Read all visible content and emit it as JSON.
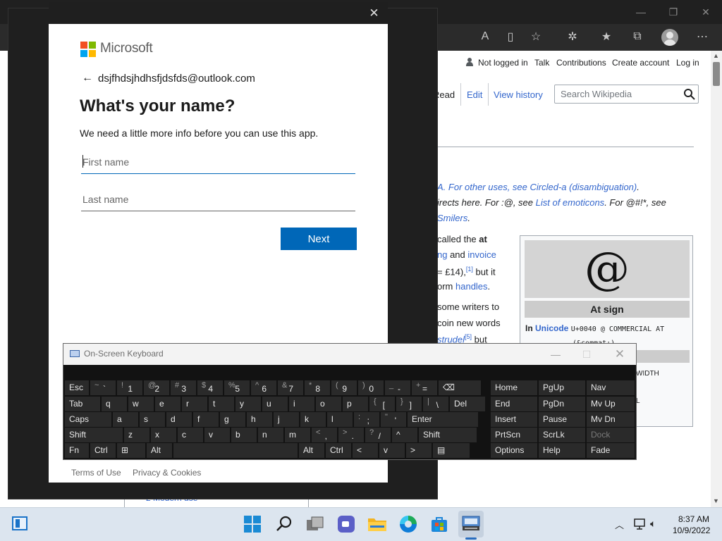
{
  "wiki": {
    "personal": {
      "not_logged_in": "Not logged in",
      "talk": "Talk",
      "contributions": "Contributions",
      "create_account": "Create account",
      "log_in": "Log in"
    },
    "tabs": {
      "read": "Read",
      "edit": "Edit",
      "history": "View history"
    },
    "search_placeholder": "Search Wikipedia",
    "hatnote": [
      [
        "A. For other uses, see ",
        "Circled-a (disambiguation)",
        "."
      ],
      [
        "irects here. For :@, see ",
        "List of emoticons",
        ". For @#!*, see"
      ],
      [
        "",
        "Smilers",
        "."
      ]
    ],
    "body_lines": [
      {
        "pre": "called the ",
        "bold": "at",
        "link": "",
        "post": ""
      },
      {
        "pre": "",
        "bold": "",
        "link": "ng",
        "mid": " and ",
        "link2": "invoice"
      },
      {
        "pre": "= £14),",
        "sup": "[1]",
        "post": " but it"
      },
      {
        "pre": "orm ",
        "link": "handles",
        "post": "."
      },
      {
        "pre": "some writers to",
        "post": ""
      },
      {
        "pre": "coin new words",
        "post": ""
      },
      {
        "link": "strudel",
        "sup": "[5]",
        "post": " but"
      }
    ],
    "infobox": {
      "symbol": "@",
      "title": "At sign",
      "label_in": "In",
      "unicode_link": "Unicode",
      "code": "U+0040 @ COMMERCIAL AT",
      "entity": "(&commat;)",
      "width_frag": "WIDTH",
      "l_frag": "L"
    },
    "footer_section": "2  Modern use"
  },
  "signin": {
    "brand": "Microsoft",
    "email": "dsjfhdsjhdhsfjdsfds@outlook.com",
    "heading": "What's your name?",
    "subtext": "We need a little more info before you can use this app.",
    "first_name_placeholder": "First name",
    "last_name_placeholder": "Last name",
    "next_label": "Next",
    "terms": "Terms of Use",
    "privacy": "Privacy & Cookies"
  },
  "osk": {
    "title": "On-Screen Keyboard",
    "rows": [
      [
        [
          "Esc",
          ""
        ],
        [
          "`",
          "~"
        ],
        [
          "1",
          "!"
        ],
        [
          "2",
          "@"
        ],
        [
          "3",
          "#"
        ],
        [
          "4",
          "$"
        ],
        [
          "5",
          "%"
        ],
        [
          "6",
          "^"
        ],
        [
          "7",
          "&"
        ],
        [
          "8",
          "*"
        ],
        [
          "9",
          "("
        ],
        [
          "0",
          ")"
        ],
        [
          "-",
          "_"
        ],
        [
          "=",
          "+"
        ],
        [
          "⌫",
          ""
        ]
      ],
      [
        [
          "Tab",
          ""
        ],
        [
          "q",
          ""
        ],
        [
          "w",
          ""
        ],
        [
          "e",
          ""
        ],
        [
          "r",
          ""
        ],
        [
          "t",
          ""
        ],
        [
          "y",
          ""
        ],
        [
          "u",
          ""
        ],
        [
          "i",
          ""
        ],
        [
          "o",
          ""
        ],
        [
          "p",
          ""
        ],
        [
          "[",
          "{"
        ],
        [
          "]",
          "}"
        ],
        [
          "\\",
          "|"
        ],
        [
          "Del",
          ""
        ]
      ],
      [
        [
          "Caps",
          ""
        ],
        [
          "a",
          ""
        ],
        [
          "s",
          ""
        ],
        [
          "d",
          ""
        ],
        [
          "f",
          ""
        ],
        [
          "g",
          ""
        ],
        [
          "h",
          ""
        ],
        [
          "j",
          ""
        ],
        [
          "k",
          ""
        ],
        [
          "l",
          ""
        ],
        [
          ";",
          ":"
        ],
        [
          "'",
          "\""
        ],
        [
          "Enter",
          ""
        ]
      ],
      [
        [
          "Shift",
          ""
        ],
        [
          "z",
          ""
        ],
        [
          "x",
          ""
        ],
        [
          "c",
          ""
        ],
        [
          "v",
          ""
        ],
        [
          "b",
          ""
        ],
        [
          "n",
          ""
        ],
        [
          "m",
          ""
        ],
        [
          ",",
          "<"
        ],
        [
          ".",
          ">"
        ],
        [
          "/",
          "?"
        ],
        [
          "^",
          ""
        ],
        [
          "Shift",
          ""
        ]
      ],
      [
        [
          "Fn",
          ""
        ],
        [
          "Ctrl",
          ""
        ],
        [
          "⊞",
          ""
        ],
        [
          "Alt",
          ""
        ],
        [
          "",
          ""
        ],
        [
          "Alt",
          ""
        ],
        [
          "Ctrl",
          ""
        ],
        [
          "<",
          ""
        ],
        [
          "v",
          ""
        ],
        [
          ">",
          ""
        ],
        [
          "▤",
          ""
        ]
      ]
    ],
    "nav_keys": [
      [
        "Home",
        "PgUp",
        "Nav"
      ],
      [
        "End",
        "PgDn",
        "Mv Up"
      ],
      [
        "Insert",
        "Pause",
        "Mv Dn"
      ],
      [
        "PrtScn",
        "ScrLk",
        "Dock"
      ],
      [
        "Options",
        "Help",
        "Fade"
      ]
    ]
  },
  "taskbar": {
    "time": "8:37 AM",
    "date": "10/9/2022"
  }
}
